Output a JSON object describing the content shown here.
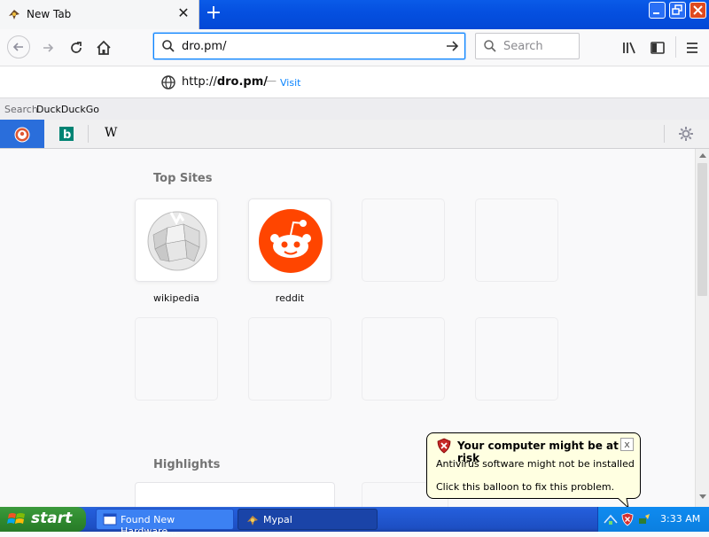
{
  "window": {
    "tab_title": "New Tab",
    "new_tab_symbol": "+",
    "close_symbol": "✕",
    "colors": {
      "titlebar": "#0550e0",
      "close": "#df4a1f"
    }
  },
  "navbar": {
    "url_value": "dro.pm/",
    "search_placeholder": "Search"
  },
  "suggestion": {
    "url_prefix": "http://",
    "url_bold": "dro.pm/",
    "dash": "—",
    "action": "Visit"
  },
  "search_with": {
    "label": "Search",
    "engine": "DuckDuckGo"
  },
  "engines": {
    "wiki_letter": "W",
    "bing_letter": "b"
  },
  "content": {
    "top_sites_heading": "Top Sites",
    "highlights_heading": "Highlights",
    "tiles": [
      {
        "label": "wikipedia"
      },
      {
        "label": "reddit"
      }
    ]
  },
  "balloon": {
    "title": "Your computer might be at risk",
    "line1": "Antivirus software might not be installed",
    "line2": "Click this balloon to fix this problem.",
    "close": "x"
  },
  "taskbar": {
    "start_label": "start",
    "tasks": [
      {
        "label": "Found New Hardware..."
      },
      {
        "label": "Mypal"
      }
    ],
    "clock": "3:33 AM"
  }
}
